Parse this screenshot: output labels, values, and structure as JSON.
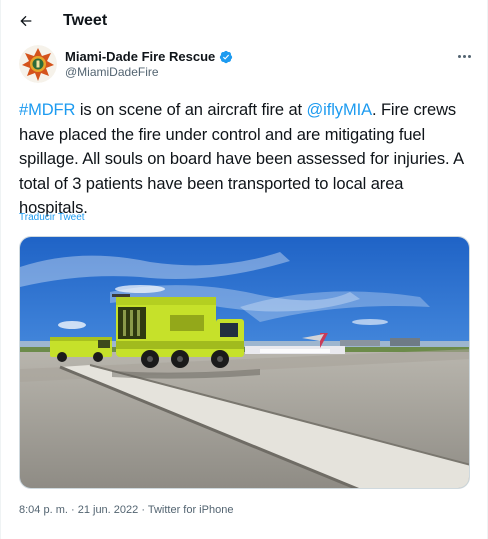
{
  "header": {
    "title": "Tweet",
    "back_icon": "arrow-left-icon"
  },
  "author": {
    "name": "Miami-Dade Fire Rescue",
    "handle": "@MiamiDadeFire",
    "verified_icon": "verified-badge-icon",
    "verified_color": "#1d9bf0"
  },
  "more_icon": "more-horizontal-icon",
  "tweet": {
    "hashtag": "#MDFR",
    "text_part1": " is on scene of an aircraft fire at ",
    "mention": "@iflyMIA",
    "text_part2": ". Fire crews have placed the fire under control and are mitigating fuel spillage. All souls on board have been assessed for injuries. A total of 3 patients have been transported to local area hospitals.",
    "link_color": "#1d9bf0"
  },
  "translate_label": "Traducir Tweet",
  "meta": {
    "time": "8:04 p. m.",
    "separator1": " · ",
    "date": "21 jun. 2022",
    "separator2": " · ",
    "source": "Twitter for iPhone"
  },
  "colors": {
    "text": "#0f1419",
    "secondary": "#536471",
    "accent": "#1d9bf0",
    "truck": "#c6e12a"
  }
}
